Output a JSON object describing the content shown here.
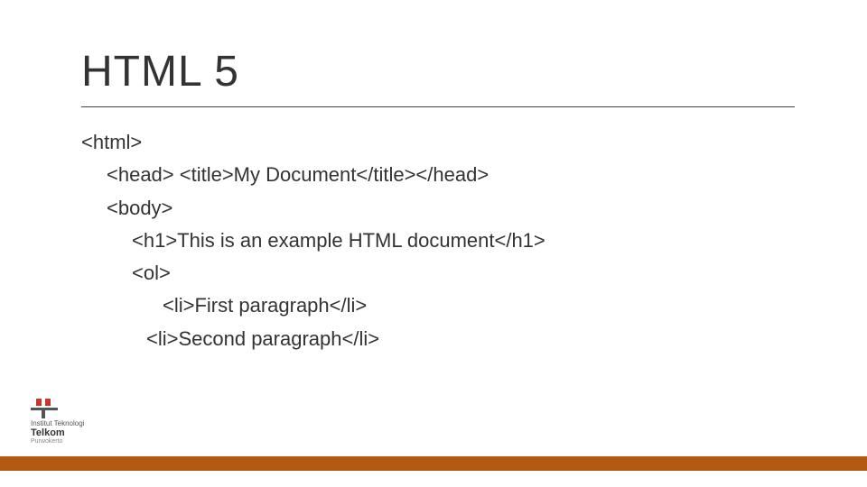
{
  "title": "HTML 5",
  "code_lines": [
    {
      "indent": 0,
      "text": "<html>"
    },
    {
      "indent": 1,
      "text": "<head> <title>My Document</title></head>"
    },
    {
      "indent": 1,
      "text": "<body>"
    },
    {
      "indent": 2,
      "text": "<h1>This is an example HTML document</h1>"
    },
    {
      "indent": 2,
      "text": "<ol>"
    },
    {
      "indent": 3,
      "text": "<li>First paragraph</li>"
    },
    {
      "indent": 3.1,
      "text": "<li>Second paragraph</li>"
    }
  ],
  "logo": {
    "line1": "Institut Teknologi",
    "line2": "Telkom",
    "line3": "Purwokerto"
  },
  "colors": {
    "footer": "#b35a12",
    "logo_red": "#c0392b"
  }
}
